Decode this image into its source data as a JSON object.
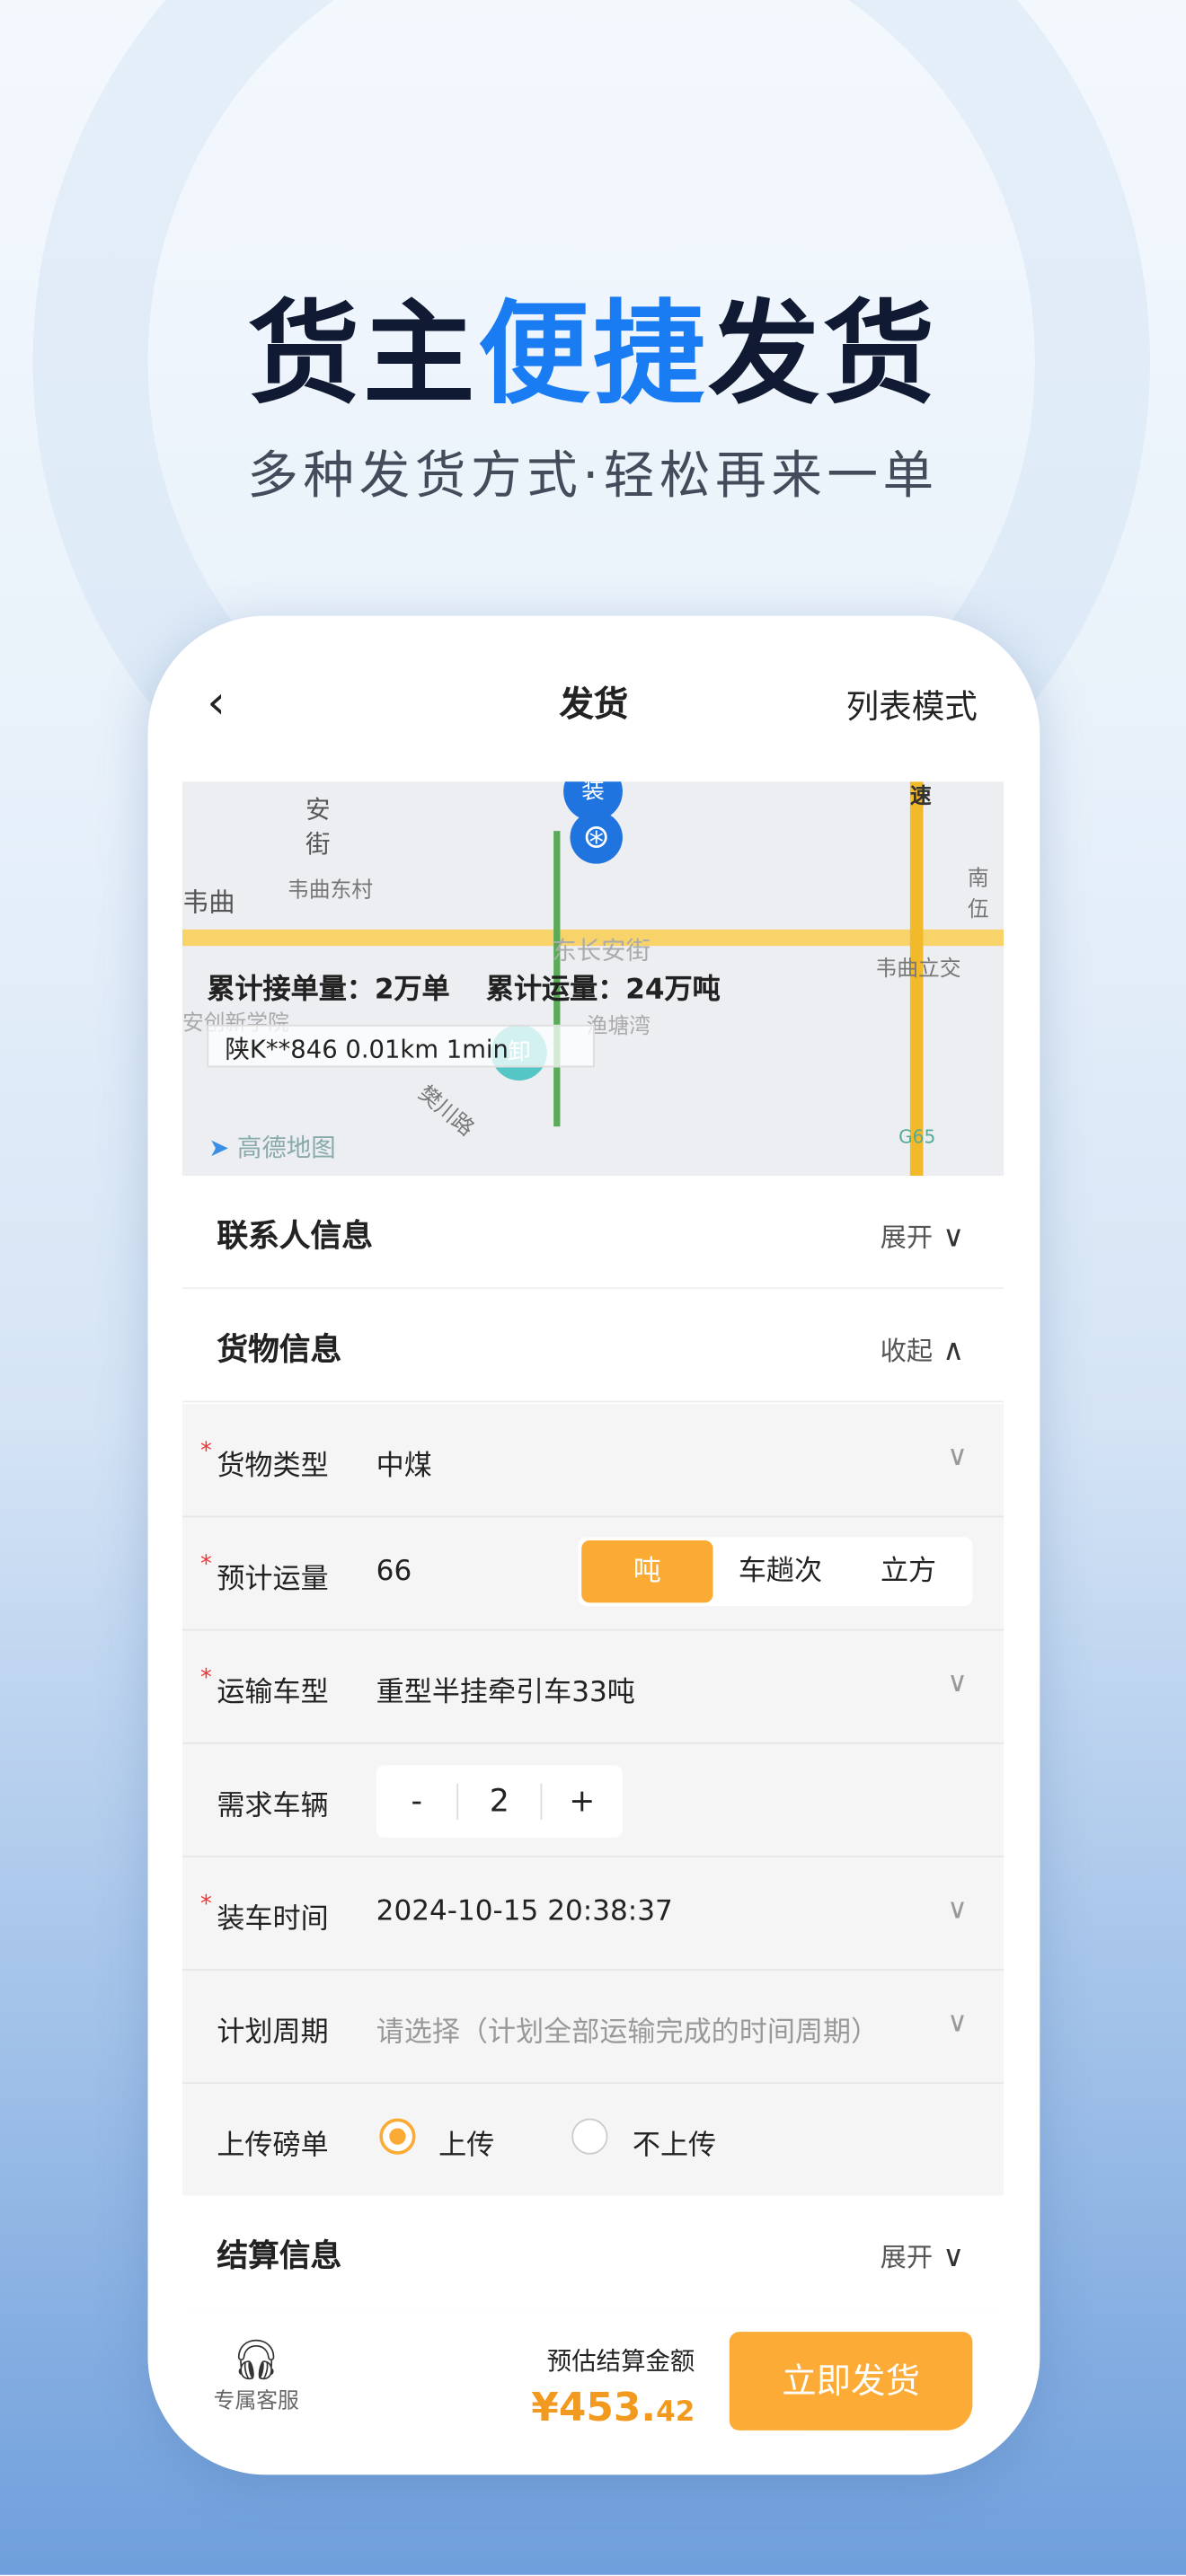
{
  "promo": {
    "title_part1": "货主",
    "title_highlight": "便捷",
    "title_part2": "发货",
    "subtitle": "多种发货方式·轻松再来一单"
  },
  "header": {
    "back": "‹",
    "title": "发货",
    "list_mode": "列表模式"
  },
  "map": {
    "stats_orders": "累计接单量：2万单",
    "stats_volume": "累计运量：24万吨",
    "vehicle": "陕K**846  0.01km  1min",
    "labels": [
      "安街",
      "韦曲",
      "韦曲东村",
      "东长安街",
      "韦曲立交",
      "安创新学院",
      "渔塘湾",
      "樊川路",
      "南伍",
      "G65",
      "速"
    ],
    "pin_start": "装",
    "pin_end": "卸",
    "logo": "高德地图"
  },
  "sections": {
    "contact": {
      "title": "联系人信息",
      "toggle": "展开"
    },
    "goods": {
      "title": "货物信息",
      "toggle": "收起"
    },
    "settle": {
      "title": "结算信息",
      "toggle": "展开"
    }
  },
  "form": {
    "cargo_type": {
      "label": "货物类型",
      "value": "中煤"
    },
    "volume": {
      "label": "预计运量",
      "value": "66",
      "units": [
        "吨",
        "车趟次",
        "立方"
      ],
      "selected": "吨"
    },
    "vehicle_type": {
      "label": "运输车型",
      "value": "重型半挂牵引车33吨"
    },
    "vehicles": {
      "label": "需求车辆",
      "minus": "-",
      "value": "2",
      "plus": "+"
    },
    "load_time": {
      "label": "装车时间",
      "value": "2024-10-15 20:38:37"
    },
    "plan_period": {
      "label": "计划周期",
      "placeholder": "请选择（计划全部运输完成的时间周期）"
    },
    "weigh_slip": {
      "label": "上传磅单",
      "options": [
        "上传",
        "不上传"
      ],
      "selected": "上传"
    }
  },
  "bottom": {
    "service": "专属客服",
    "estimate_label": "预估结算金额",
    "price_main": "¥453.",
    "price_cents": "42",
    "submit": "立即发货"
  },
  "colors": {
    "accent": "#fbaa33",
    "brand_blue": "#1a7cf2",
    "price": "#f19a1f"
  }
}
